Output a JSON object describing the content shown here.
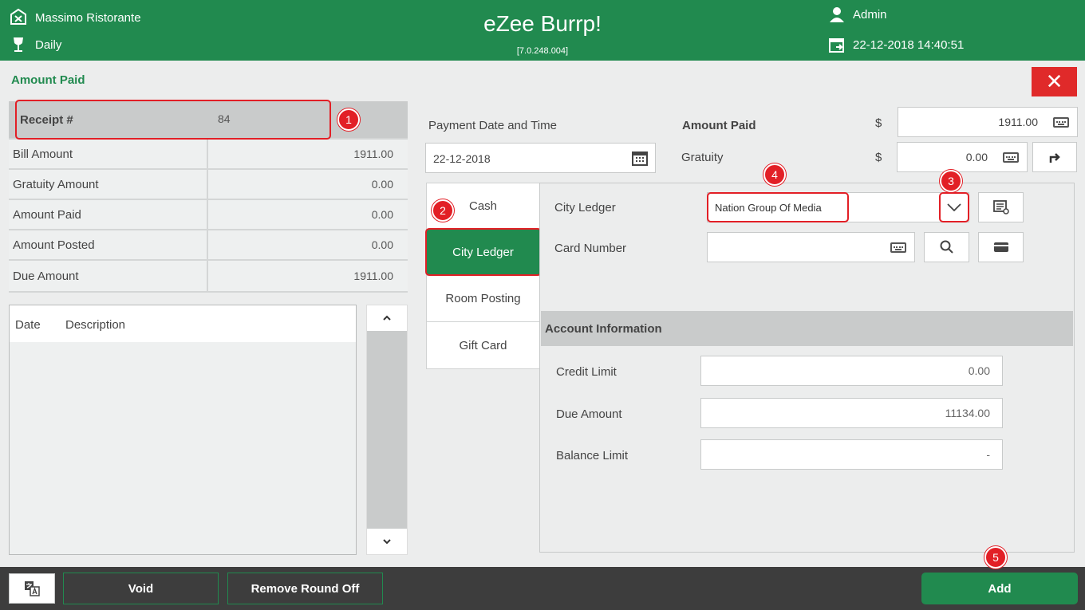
{
  "header": {
    "restaurant": "Massimo Ristorante",
    "mode": "Daily",
    "app_title": "eZee Burrp!",
    "version": "[7.0.248.004]",
    "user": "Admin",
    "datetime": "22-12-2018 14:40:51"
  },
  "section_title": "Amount Paid",
  "close_label": "✕",
  "summary": {
    "receipt_label": "Receipt #",
    "receipt_value": "84",
    "rows": [
      {
        "label": "Bill Amount",
        "value": "1911.00"
      },
      {
        "label": "Gratuity Amount",
        "value": "0.00"
      },
      {
        "label": "Amount Paid",
        "value": "0.00"
      },
      {
        "label": "Amount Posted",
        "value": "0.00"
      },
      {
        "label": "Due Amount",
        "value": "1911.00"
      }
    ]
  },
  "list": {
    "col_date": "Date",
    "col_description": "Description"
  },
  "scroll": {
    "up": "⌃",
    "down": "⌄"
  },
  "payment": {
    "date_label": "Payment Date and Time",
    "date_value": "22-12-2018",
    "amount_paid_label": "Amount Paid",
    "currency": "$",
    "amount_paid_value": "1911.00",
    "gratuity_label": "Gratuity",
    "gratuity_value": "0.00"
  },
  "tabs": [
    {
      "label": "Cash"
    },
    {
      "label": "City Ledger"
    },
    {
      "label": "Room Posting"
    },
    {
      "label": "Gift Card"
    }
  ],
  "city_ledger": {
    "ledger_label": "City Ledger",
    "ledger_value": "Nation Group Of Media",
    "card_label": "Card Number",
    "card_value": ""
  },
  "account": {
    "title": "Account Information",
    "credit_limit_label": "Credit Limit",
    "credit_limit_value": "0.00",
    "due_amount_label": "Due Amount",
    "due_amount_value": "11134.00",
    "balance_limit_label": "Balance Limit",
    "balance_limit_value": "-"
  },
  "footer": {
    "void_label": "Void",
    "remove_round_off_label": "Remove Round Off",
    "add_label": "Add"
  },
  "badges": [
    "1",
    "2",
    "3",
    "4",
    "5"
  ],
  "colors": {
    "brand": "#218a4f",
    "highlight": "#e21f26",
    "close": "#e02a2a"
  }
}
